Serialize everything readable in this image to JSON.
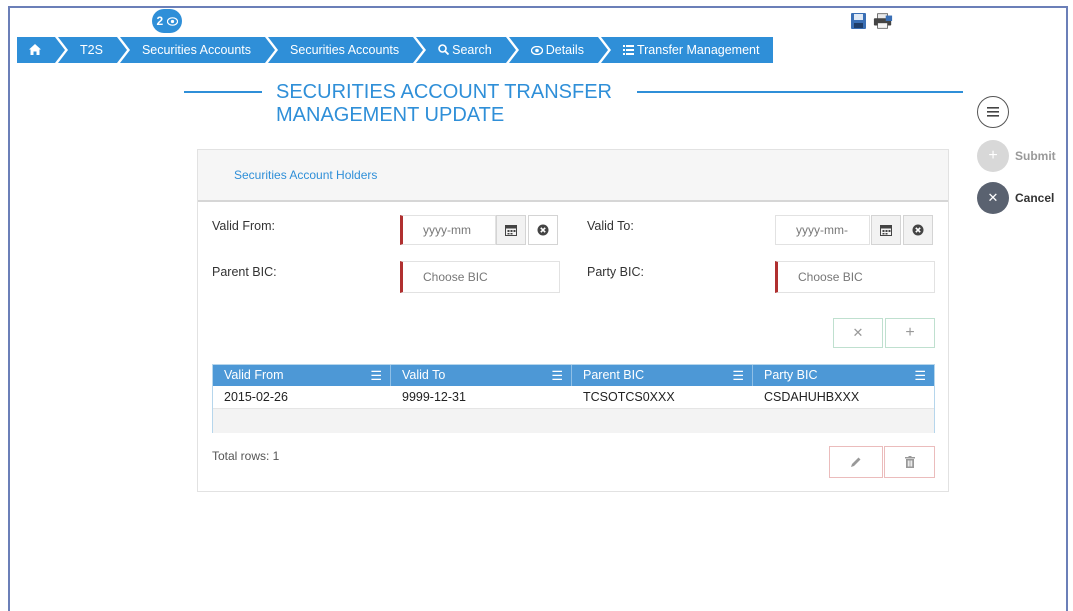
{
  "breadcrumb": {
    "badge": "2",
    "items": [
      {
        "label": "",
        "icon": "home-icon"
      },
      {
        "label": "T2S"
      },
      {
        "label": "Securities Accounts"
      },
      {
        "label": "Securities Accounts"
      },
      {
        "label": "Search",
        "icon": "search-icon"
      },
      {
        "label": "Details",
        "icon": "eye-icon"
      },
      {
        "label": "Transfer Management",
        "icon": "list-icon"
      }
    ]
  },
  "page": {
    "title": "SECURITIES ACCOUNT TRANSFER MANAGEMENT UPDATE"
  },
  "actions": {
    "submit_label": "Submit",
    "cancel_label": "Cancel"
  },
  "panel": {
    "header": "Securities Account Holders",
    "valid_from_label": "Valid From:",
    "valid_from_placeholder": "yyyy-mm",
    "valid_to_label": "Valid To:",
    "valid_to_placeholder": "yyyy-mm-",
    "parent_bic_label": "Parent BIC:",
    "parent_bic_placeholder": "Choose BIC",
    "party_bic_label": "Party BIC:",
    "party_bic_placeholder": "Choose BIC"
  },
  "table": {
    "columns": [
      "Valid From",
      "Valid To",
      "Parent BIC",
      "Party BIC"
    ],
    "rows": [
      [
        "2015-02-26",
        "9999-12-31",
        "TCSOTCS0XXX",
        "CSDAHUHBXXX"
      ]
    ],
    "total_rows": "Total rows: 1"
  },
  "colors": {
    "accent": "#2f8fd8",
    "mandatory": "#b03030",
    "cancel": "#5a6270"
  }
}
